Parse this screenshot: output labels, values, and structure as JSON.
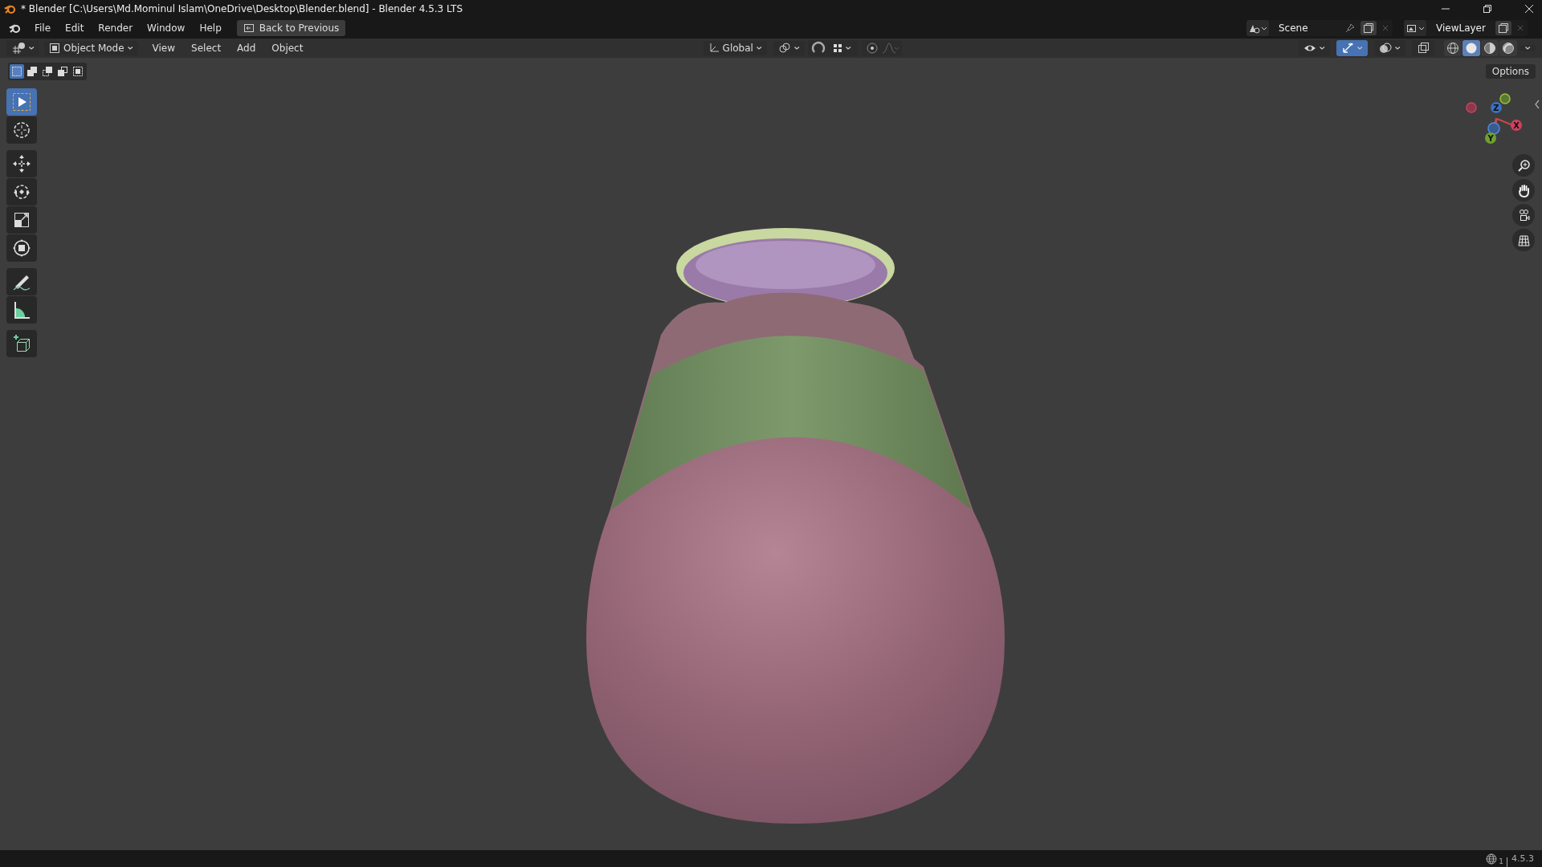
{
  "window": {
    "title": "* Blender [C:\\Users\\Md.Mominul Islam\\OneDrive\\Desktop\\Blender.blend] - Blender 4.5.3 LTS"
  },
  "menu": [
    "File",
    "Edit",
    "Render",
    "Window",
    "Help"
  ],
  "back_button": "Back to Previous",
  "scene": "Scene",
  "view_layer": "ViewLayer",
  "header": {
    "mode": "Object Mode",
    "menus": [
      "View",
      "Select",
      "Add",
      "Object"
    ],
    "orientation": "Global",
    "toggles": [
      {
        "kind": "visibility",
        "on": false
      },
      {
        "kind": "gizmo",
        "on": true
      },
      {
        "kind": "overlay",
        "on": false
      },
      {
        "kind": "xray",
        "on": false
      }
    ],
    "shading": [
      {
        "kind": "wireframe",
        "selected": false
      },
      {
        "kind": "solid",
        "selected": true
      },
      {
        "kind": "material",
        "selected": false
      },
      {
        "kind": "rendered",
        "selected": false
      }
    ]
  },
  "selection_modes": [
    {
      "kind": "set",
      "selected": true
    },
    {
      "kind": "extend",
      "selected": false
    },
    {
      "kind": "subtract",
      "selected": false
    },
    {
      "kind": "difference",
      "selected": false
    },
    {
      "kind": "intersect",
      "selected": false
    }
  ],
  "options": "Options",
  "tool_groups": [
    [
      {
        "kind": "select",
        "selected": true
      },
      {
        "kind": "cursor",
        "selected": false
      }
    ],
    [
      {
        "kind": "move",
        "selected": false
      },
      {
        "kind": "rotate",
        "selected": false
      },
      {
        "kind": "scale",
        "selected": false
      },
      {
        "kind": "transform",
        "selected": false
      }
    ],
    [
      {
        "kind": "annotate",
        "selected": false
      },
      {
        "kind": "measure",
        "selected": false
      }
    ],
    [
      {
        "kind": "add_cube",
        "selected": false
      }
    ]
  ],
  "gizmo": {
    "x": "X",
    "y": "Y",
    "z": "Z"
  },
  "status": {
    "count": "1",
    "version": "4.5.3"
  }
}
